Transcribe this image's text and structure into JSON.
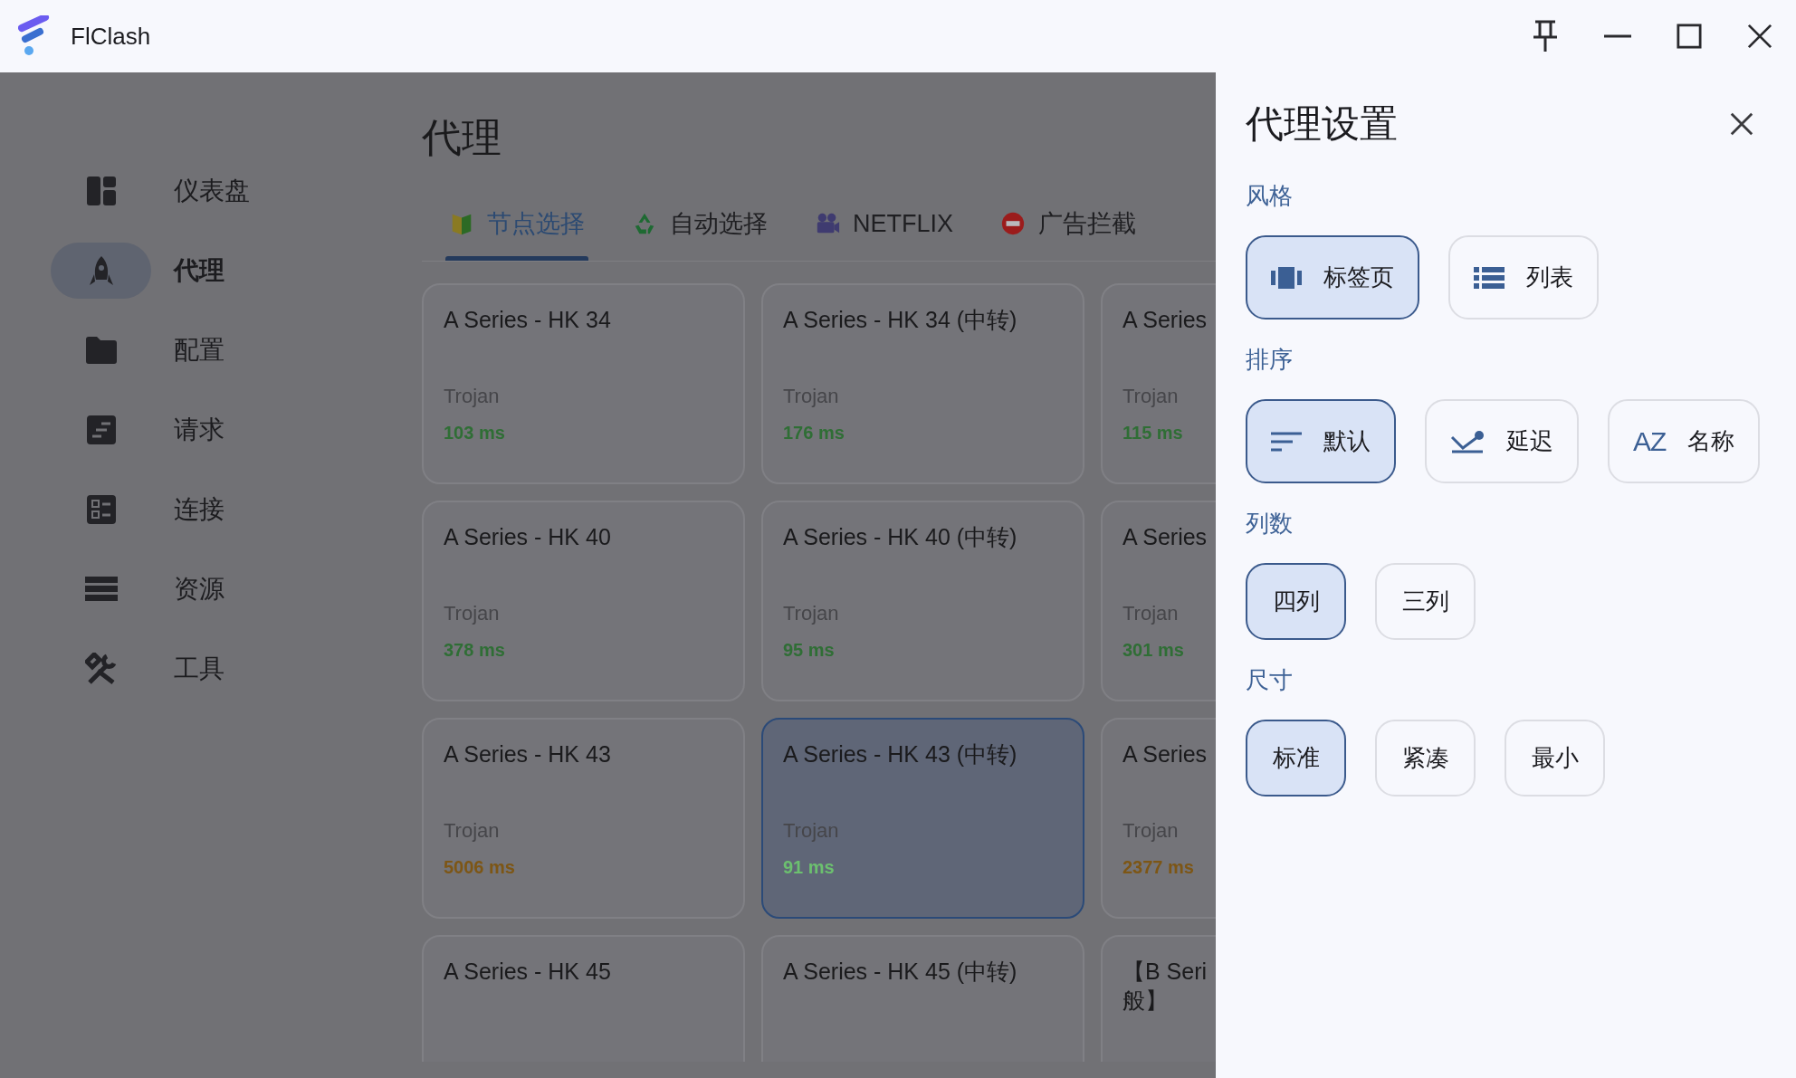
{
  "window": {
    "title": "FlClash"
  },
  "sidebar": {
    "items": [
      {
        "label": "仪表盘",
        "kind": "dashboard",
        "selected": false
      },
      {
        "label": "代理",
        "kind": "rocket",
        "selected": true
      },
      {
        "label": "配置",
        "kind": "folder",
        "selected": false
      },
      {
        "label": "请求",
        "kind": "request",
        "selected": false
      },
      {
        "label": "连接",
        "kind": "connections",
        "selected": false
      },
      {
        "label": "资源",
        "kind": "storage",
        "selected": false
      },
      {
        "label": "工具",
        "kind": "tools",
        "selected": false
      }
    ]
  },
  "page": {
    "title": "代理"
  },
  "tabs": [
    {
      "label": "节点选择",
      "kind": "flag",
      "selected": true
    },
    {
      "label": "自动选择",
      "kind": "recycle",
      "selected": false
    },
    {
      "label": "NETFLIX",
      "kind": "camera",
      "selected": false
    },
    {
      "label": "广告拦截",
      "kind": "noentry",
      "selected": false
    }
  ],
  "proxies": [
    {
      "name": "A Series - HK 34",
      "protocol": "Trojan",
      "latency": "103 ms",
      "color": "#2f6e35",
      "selected": false
    },
    {
      "name": "A Series - HK 34 (中转)",
      "protocol": "Trojan",
      "latency": "176 ms",
      "color": "#2f6e35",
      "selected": false
    },
    {
      "name": "A Series",
      "protocol": "Trojan",
      "latency": "115 ms",
      "color": "#2f6e35",
      "selected": false
    },
    {
      "name": "A Series - HK 40",
      "protocol": "Trojan",
      "latency": "378 ms",
      "color": "#2f6e35",
      "selected": false
    },
    {
      "name": "A Series - HK 40 (中转)",
      "protocol": "Trojan",
      "latency": "95 ms",
      "color": "#2f6e35",
      "selected": false
    },
    {
      "name": "A Series",
      "protocol": "Trojan",
      "latency": "301 ms",
      "color": "#2f6e35",
      "selected": false
    },
    {
      "name": "A Series - HK 43",
      "protocol": "Trojan",
      "latency": "5006 ms",
      "color": "#7d5615",
      "selected": false
    },
    {
      "name": "A Series - HK 43 (中转)",
      "protocol": "Trojan",
      "latency": "91 ms",
      "color": "#6cc06f",
      "selected": true
    },
    {
      "name": "A Series",
      "protocol": "Trojan",
      "latency": "2377 ms",
      "color": "#7d5615",
      "selected": false
    },
    {
      "name": "A Series - HK 45",
      "selected": false
    },
    {
      "name": "A Series - HK 45 (中转)",
      "selected": false
    },
    {
      "name": "【B Seri\n般】",
      "selected": false
    }
  ],
  "drawer": {
    "title": "代理设置",
    "sections": [
      {
        "label": "风格",
        "options": [
          {
            "label": "标签页",
            "kind": "tabs",
            "selected": true
          },
          {
            "label": "列表",
            "kind": "list",
            "selected": false
          }
        ]
      },
      {
        "label": "排序",
        "options": [
          {
            "label": "默认",
            "kind": "sort",
            "selected": true
          },
          {
            "label": "延迟",
            "kind": "latency",
            "selected": false
          },
          {
            "label": "名称",
            "kind": "az",
            "icon_text": "AZ",
            "selected": false
          }
        ]
      },
      {
        "label": "列数",
        "options": [
          {
            "label": "四列",
            "selected": true
          },
          {
            "label": "三列",
            "selected": false
          }
        ]
      },
      {
        "label": "尺寸",
        "options": [
          {
            "label": "标准",
            "selected": true
          },
          {
            "label": "紧凑",
            "selected": false
          },
          {
            "label": "最小",
            "selected": false
          }
        ]
      }
    ]
  }
}
